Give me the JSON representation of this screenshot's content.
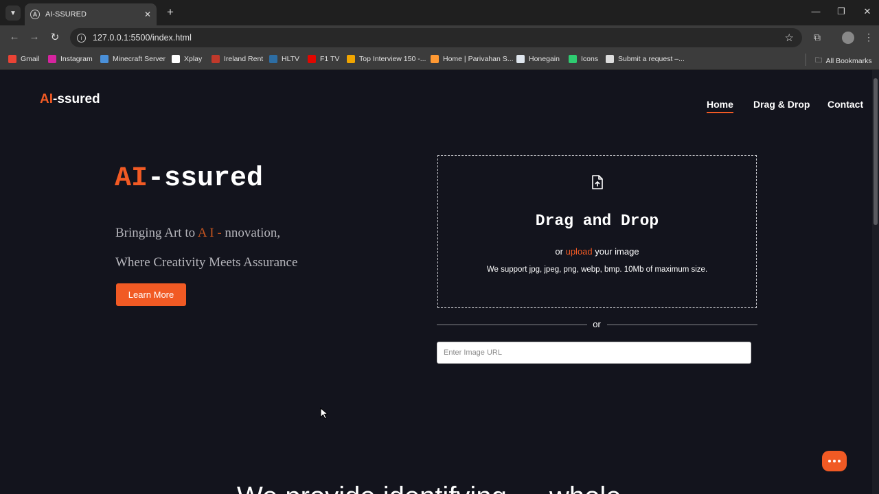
{
  "browser": {
    "tab_title": "AI-SSURED",
    "url": "127.0.0.1:5500/index.html",
    "bookmarks": [
      {
        "label": "Gmail",
        "color": "#ea4335"
      },
      {
        "label": "Instagram",
        "color": "#d6249f"
      },
      {
        "label": "Minecraft Server",
        "color": "#4a90d9"
      },
      {
        "label": "Xplay",
        "color": "#ffffff"
      },
      {
        "label": "Ireland Rent",
        "color": "#c0392b"
      },
      {
        "label": "HLTV",
        "color": "#2d6da3"
      },
      {
        "label": "F1 TV",
        "color": "#e10600"
      },
      {
        "label": "Top Interview 150 -...",
        "color": "#f0a500"
      },
      {
        "label": "Home | Parivahan S...",
        "color": "#ff9933"
      },
      {
        "label": "Honegain",
        "color": "#dfe6ee"
      },
      {
        "label": "Icons",
        "color": "#2ecc71"
      },
      {
        "label": "Submit a request –...",
        "color": "#dddddd"
      }
    ],
    "all_bookmarks": "All Bookmarks"
  },
  "header": {
    "logo_accent": "AI",
    "logo_rest": "-ssured",
    "nav": [
      {
        "label": "Home",
        "active": true
      },
      {
        "label": "Drag & Drop",
        "active": false
      },
      {
        "label": "Contact",
        "active": false
      }
    ]
  },
  "hero": {
    "title_accent": "AI",
    "title_rest": "-ssured",
    "line1_before": "Bringing Art to ",
    "line1_accent": "A I -",
    "line1_after": " nnovation,",
    "line2": "Where Creativity Meets Assurance",
    "cta": "Learn More"
  },
  "dropzone": {
    "title": "Drag and Drop",
    "sub_before": "or ",
    "sub_link": "upload",
    "sub_after": " your image",
    "note": "We support jpg, jpeg, png, webp, bmp. 10Mb of maximum size."
  },
  "divider_text": "or",
  "url_input_placeholder": "Enter Image URL",
  "bottom_heading": "We provide identifying … whole",
  "colors": {
    "accent": "#f15a24",
    "background": "#13141d"
  }
}
